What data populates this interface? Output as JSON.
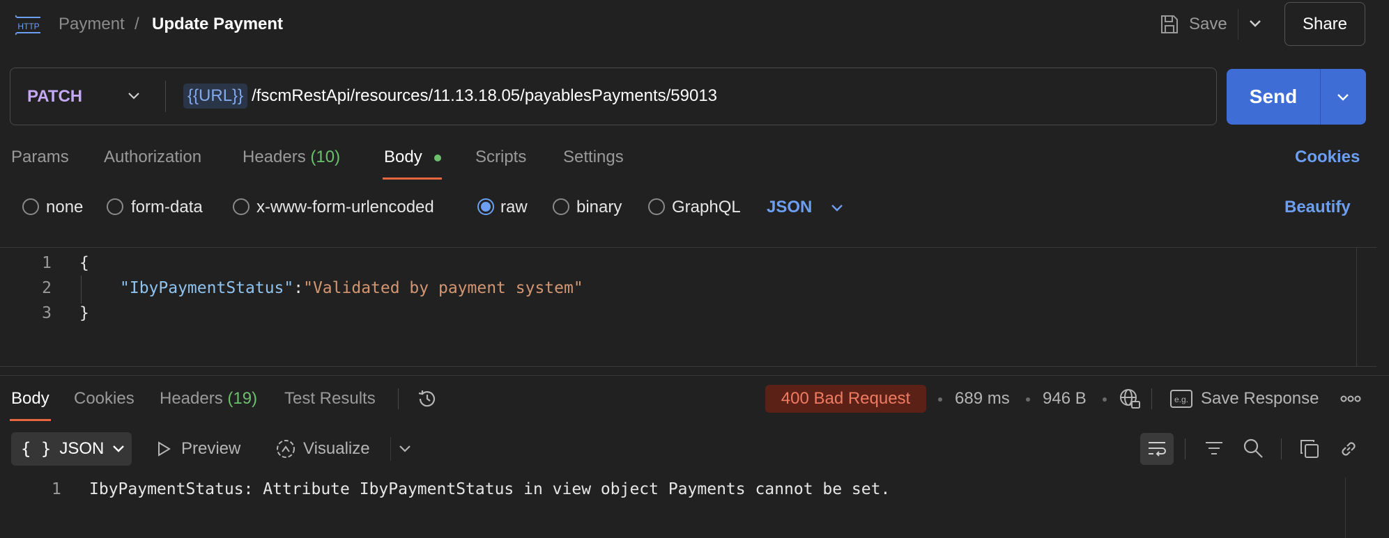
{
  "header": {
    "request_type": "HTTP",
    "breadcrumb_parent": "Payment",
    "breadcrumb_separator": "/",
    "breadcrumb_current": "Update Payment",
    "save_label": "Save",
    "share_label": "Share"
  },
  "url_bar": {
    "method": "PATCH",
    "variable": "{{URL}}",
    "path": "/fscmRestApi/resources/11.13.18.05/payablesPayments/59013",
    "send_label": "Send"
  },
  "request_tabs": [
    {
      "label": "Params",
      "count": "",
      "active": false
    },
    {
      "label": "Authorization",
      "count": "",
      "active": false
    },
    {
      "label": "Headers",
      "count": "(10)",
      "active": false
    },
    {
      "label": "Body",
      "count": "",
      "active": true
    },
    {
      "label": "Scripts",
      "count": "",
      "active": false
    },
    {
      "label": "Settings",
      "count": "",
      "active": false
    }
  ],
  "cookies_label": "Cookies",
  "body_types": {
    "options": [
      "none",
      "form-data",
      "x-www-form-urlencoded",
      "raw",
      "binary",
      "GraphQL"
    ],
    "selected": "raw",
    "format": "JSON",
    "beautify_label": "Beautify"
  },
  "editor": {
    "line_numbers": [
      "1",
      "2",
      "3"
    ],
    "open_brace": "{",
    "key": "\"IbyPaymentStatus\"",
    "colon": ":",
    "value": "\"Validated by payment system\"",
    "close_brace": "}"
  },
  "response": {
    "tabs": [
      {
        "label": "Body",
        "count": "",
        "active": true
      },
      {
        "label": "Cookies",
        "count": "",
        "active": false
      },
      {
        "label": "Headers",
        "count": "(19)",
        "active": false
      },
      {
        "label": "Test Results",
        "count": "",
        "active": false
      }
    ],
    "status": "400 Bad Request",
    "time": "689 ms",
    "size": "946 B",
    "save_response_label": "Save Response",
    "view_format": "JSON",
    "preview_label": "Preview",
    "visualize_label": "Visualize",
    "output_line_number": "1",
    "output_text": "IbyPaymentStatus: Attribute IbyPaymentStatus in view object Payments cannot be set."
  },
  "colors": {
    "background": "#212121",
    "accent_blue": "#3e6dd6",
    "link_blue": "#6c9ff2",
    "method_purple": "#c4a8f4",
    "status_error": "#f07b63",
    "count_green": "#6cbf6c",
    "tab_underline": "#e8663f"
  }
}
